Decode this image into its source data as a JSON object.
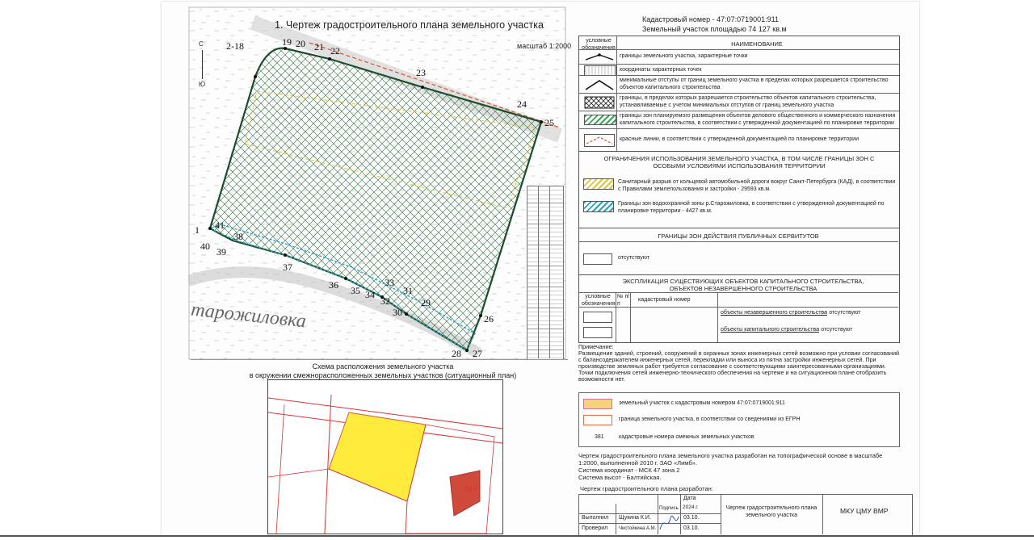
{
  "plan_title": "1. Чертеж градостроительного плана земельного участка",
  "cadastral": {
    "number_line": "Кадастровый номер - 47:07:0719001:911",
    "area_line": "Земельный участок площадью 74 127 кв.м"
  },
  "scale": "масштаб 1:2000",
  "compass": {
    "north": "С",
    "south": "Ю"
  },
  "map_label": "тарожиловка",
  "points": [
    "1",
    "2-18",
    "19",
    "20",
    "21",
    "22",
    "23",
    "24",
    "25",
    "26",
    "27",
    "28",
    "29",
    "30",
    "31",
    "32",
    "33",
    "34",
    "35",
    "36",
    "37",
    "38",
    "39",
    "40",
    "41"
  ],
  "legend": {
    "col_symbols": "условные обозначения",
    "col_name": "НАИМЕНОВАНИЕ",
    "items": [
      "границы земельного участка, характерные точки",
      "координаты характерных точек",
      "минимальные отступы от границ земельного участка в пределах которых разрешается строительство объектов капитального строительства",
      "границы, в пределах которых разрешается строительство объектов капитального строительства, устанавливаемые с учетом минимальных отступов от границ земельного участка",
      "границы зон планируемого размещения объектов делового общественного и коммерческого назначения капитального строительства, в соответствии с утвержденной документацией по планировке территории",
      "красные линии, в соответствии с утвержденной документацией по планировке территории"
    ]
  },
  "restrictions": {
    "title": "ОГРАНИЧЕНИЯ ИСПОЛЬЗОВАНИЯ ЗЕМЕЛЬНОГО УЧАСТКА, В ТОМ ЧИСЛЕ ГРАНИЦЫ ЗОН С ОСОБЫМИ УСЛОВИЯМИ ИСПОЛЬЗОВАНИЯ ТЕРРИТОРИИ",
    "items": [
      "Санитарный разрыв от кольцевой автомобильной дороги вокруг Санкт-Петербурга (КАД), в соответствии с Правилами землепользования и застройки - 29593 кв.м.",
      "Границы зон водоохранной зоны р.Старожиловка, в соответствии с утвержденной документацией по планировке территории - 4427 кв.м."
    ]
  },
  "servitudes": {
    "title": "ГРАНИЦЫ ЗОН ДЕЙСТВИЯ ПУБЛИЧНЫХ СЕРВИТУТОВ",
    "value": "отсутствуют"
  },
  "explication": {
    "title": "ЭКСПЛИКАЦИЯ СУЩЕСТВУЮЩИХ ОБЪЕКТОВ КАПИТАЛЬНОГО СТРОИТЕЛЬСТВА, ОБЪЕКТОВ НЕЗАВЕРШЕННОГО СТРОИТЕЛЬСТВА",
    "col1": "условные обозначения",
    "col2": "№ п/п",
    "col3": "кадастровый номер",
    "row1_label": "объекты незавершенного строительства",
    "row1_value": "- отсутствуют",
    "row2_label": "объекты капитального строительства",
    "row2_value": "- отсутствуют"
  },
  "notes": {
    "title": "Примечание:",
    "text": "Размещение зданий, строений, сооружений в охранных зонах инженерных сетей возможно при условии согласований с балансодержателем инженерных сетей, перекладки или выноса из пятна застройки инженерных сетей. При производстве земляных работ требуется согласование с соответствующими заинтересованными организациями. Точки подключения сетей инженерно-технического обеспечения на чертеже и на ситуационном плане отобразить возможности нет."
  },
  "situation": {
    "title1": "Схема расположения земельного участка",
    "title2": "в окружении смежнорасположенных земельных участков (ситуационный план)",
    "num_344": "344",
    "legend_yellow": "земельный участок с кадастровым номером 47:07:0719001:911",
    "legend_border": "граница земельного участка, в соответствии со сведениями из ЕГРН",
    "legend_num": "381",
    "legend_num_text": "кадастровые номера смежных земельных участков"
  },
  "footer": {
    "text": "Чертеж градостроительного плана земельного участка разработан на топографической основе в масштабе 1:2000, выполненной 2010 г. ЗАО «Лимб».",
    "system": "Система координат - МСК 47 зона 2",
    "heights": "Система высот - Балтийская.",
    "developed": "Чертеж градостроительного плана разработан:"
  },
  "stamp": {
    "date_label": "Дата",
    "sign_label": "Подпись",
    "year": "2024 г.",
    "row1_role": "Выполнил",
    "row1_name": "Щукина К.И.",
    "row1_date": "03.10.",
    "row2_role": "Проверил",
    "row2_name": "Чистойкина А.М.",
    "row2_date": "03.10.",
    "doc_title": "Чертеж градостроительного плана земельного участка",
    "org": "МКУ ЦМУ ВМР"
  },
  "colors": {
    "parcel_green": "#1e4d2e",
    "hatch": "#2e6b3e",
    "water_zone": "#2aa3b8",
    "sanitary": "#d8c83a",
    "red_line": "#d9532c",
    "yellow_fill": "#ffeb3b"
  }
}
